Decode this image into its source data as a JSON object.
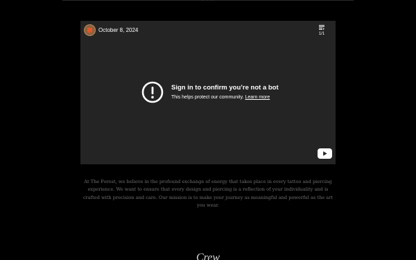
{
  "video": {
    "date": "October 8, 2024",
    "playlist_count": "1/1",
    "error_title": "Sign in to confirm you’re not a bot",
    "error_subtitle": "This helps protect our community.",
    "learn_more": "Learn more",
    "icons": {
      "avatar": "channel-avatar",
      "playlist": "playlist-icon",
      "error": "exclamation-circle-icon",
      "logo": "youtube-logo"
    }
  },
  "description": "At The Forest, we believe in the profound exchange of energy that takes place in every tattoo and piercing experience. We want to ensure that every design and piercing is a reflection of your individuality and is crafted with precision and care. Our mission is to make your journey as meaningful and powerful as the art you wear.",
  "section": {
    "heading": "Crew"
  },
  "colors": {
    "background": "#000000",
    "video_bg": "#242424",
    "text_muted": "#707070",
    "youtube_red": "#ffffff"
  }
}
